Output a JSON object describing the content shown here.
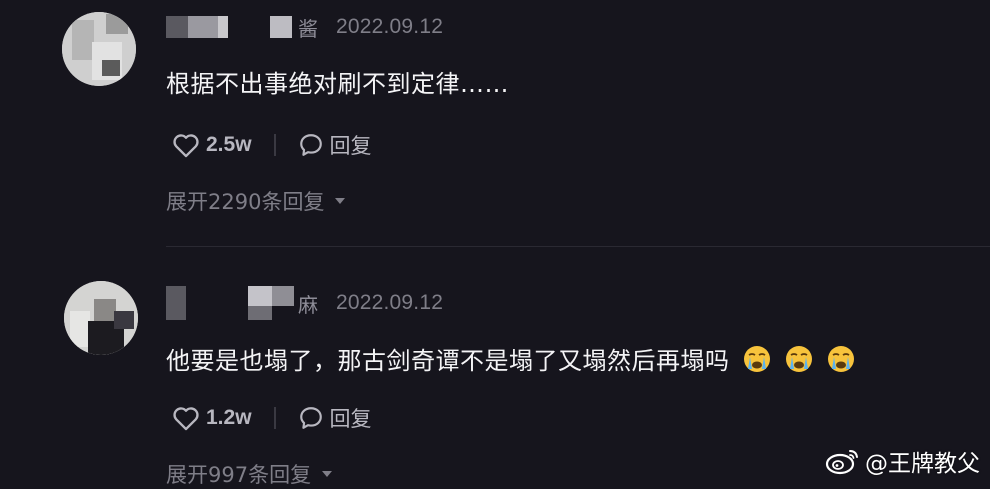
{
  "comments": [
    {
      "user_suffix": "酱",
      "date": "2022.09.12",
      "text": "根据不出事绝对刷不到定律……",
      "likes": "2.5w",
      "reply_label": "回复",
      "expand_label": "展开2290条回复"
    },
    {
      "user_suffix": "麻",
      "date": "2022.09.12",
      "text": "他要是也塌了，那古剑奇谭不是塌了又塌然后再塌吗",
      "emojis": [
        "crying-face",
        "crying-face",
        "crying-face"
      ],
      "likes": "1.2w",
      "reply_label": "回复",
      "expand_label": "展开997条回复"
    }
  ],
  "watermark": {
    "platform_icon": "weibo-icon",
    "text": "@王牌教父"
  },
  "colors": {
    "background": "#16151d",
    "primary_text": "#f4f4f6",
    "secondary_text": "#7f7e88",
    "action_text": "#b8b7c0"
  }
}
